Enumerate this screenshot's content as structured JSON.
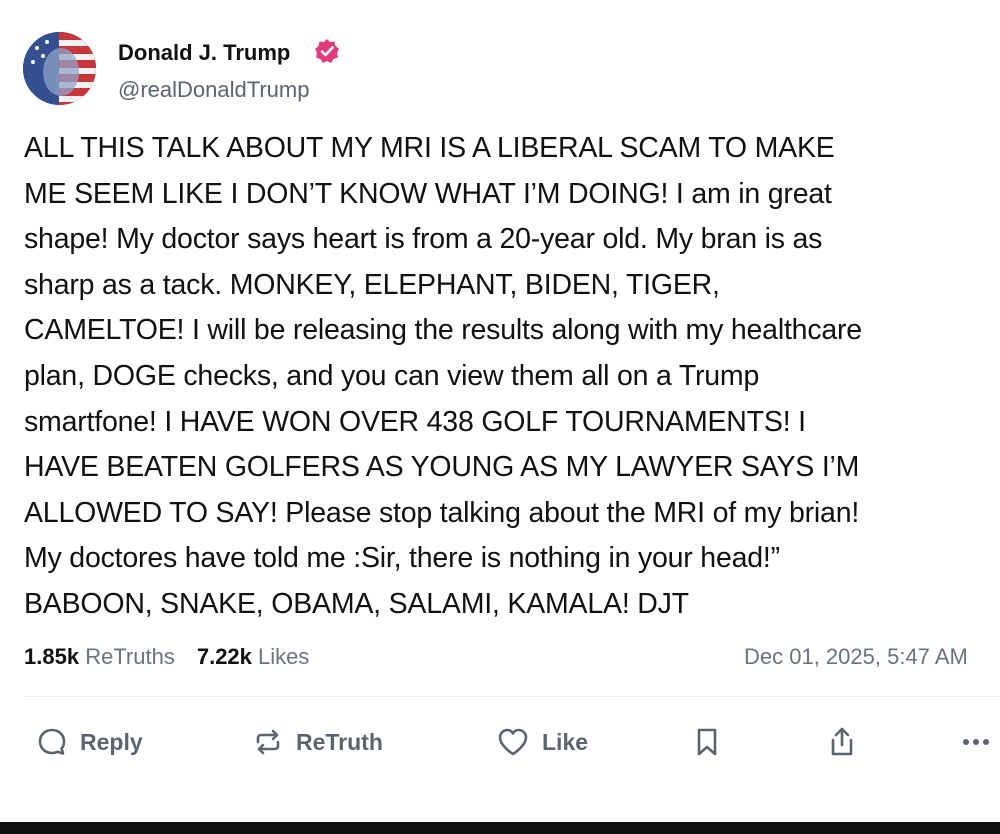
{
  "post": {
    "author_name": "Donald J. Trump",
    "handle": "@realDonaldTrump",
    "verified": true,
    "body_lines": [
      "ALL THIS TALK ABOUT MY MRI IS A LIBERAL SCAM TO MAKE",
      "ME SEEM LIKE I DON’T KNOW WHAT I’M DOING! I am in great",
      "shape! My doctor says heart is from a 20-year old. My bran is as",
      "sharp as a tack. MONKEY, ELEPHANT, BIDEN, TIGER,",
      "CAMELTOE!  I will be releasing the results along with my healthcare",
      "plan, DOGE checks, and you can view them all on a Trump",
      "smartfone! I HAVE WON OVER 438 GOLF TOURNAMENTS! I",
      "HAVE BEATEN GOLFERS AS YOUNG AS MY LAWYER SAYS I’M",
      "ALLOWED TO SAY! Please stop talking about the MRI of my brian!",
      "My doctores have told me :Sir, there is nothing in your head!”",
      "BABOON, SNAKE, OBAMA, SALAMI, KAMALA! DJT"
    ]
  },
  "stats": {
    "retruths_count": "1.85k",
    "retruths_label": "ReTruths",
    "likes_count": "7.22k",
    "likes_label": "Likes",
    "timestamp": "Dec 01, 2025, 5:47 AM"
  },
  "actions": {
    "reply_label": "Reply",
    "retruth_label": "ReTruth",
    "like_label": "Like"
  },
  "icons": {
    "verified": "verified-badge-icon",
    "reply": "speech-bubble-icon",
    "retruth": "repost-arrows-icon",
    "like": "heart-icon",
    "bookmark": "bookmark-icon",
    "share": "share-upload-icon",
    "more": "more-dots-icon"
  },
  "colors": {
    "text": "#111111",
    "muted": "#5b6470",
    "verified_badge": "#e23a7a"
  }
}
